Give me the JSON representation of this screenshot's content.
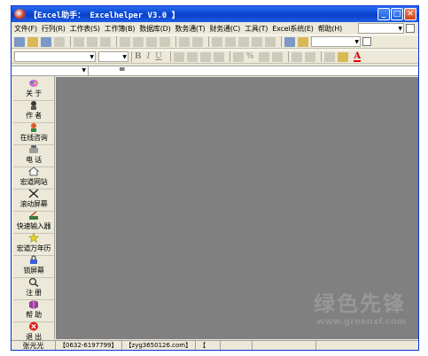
{
  "window": {
    "title": "【Excel助手： Excelhelper V3.0 】",
    "controls": {
      "minimize": "_",
      "maximize": "□",
      "close": "✕"
    }
  },
  "menu": {
    "items": [
      "文件(F)",
      "行列(R)",
      "工作表(S)",
      "工作簿(B)",
      "数据库(D)",
      "数务通(T)",
      "财务通(C)",
      "工具(T)",
      "Excel系统(E)",
      "帮助(H)"
    ]
  },
  "toolbar": {
    "bold": "B",
    "italic": "I",
    "underline": "U",
    "percent": "%",
    "font_color": "A"
  },
  "formula_bar": {
    "equals": "="
  },
  "sidebar": {
    "items": [
      {
        "label": "关 于",
        "icon": "about-icon"
      },
      {
        "label": "作 者",
        "icon": "author-icon"
      },
      {
        "label": "在线咨询",
        "icon": "online-consult-icon"
      },
      {
        "label": "电 话",
        "icon": "phone-icon"
      },
      {
        "label": "宏道网站",
        "icon": "website-icon"
      },
      {
        "label": "滚动屏幕",
        "icon": "scroll-screen-icon"
      },
      {
        "label": "快速输入器",
        "icon": "quick-input-icon"
      },
      {
        "label": "宏道万年历",
        "icon": "calendar-icon"
      },
      {
        "label": "锁屏幕",
        "icon": "lock-screen-icon"
      },
      {
        "label": "注 册",
        "icon": "register-icon"
      },
      {
        "label": "帮 助",
        "icon": "help-book-icon"
      },
      {
        "label": "退 出",
        "icon": "exit-icon"
      }
    ]
  },
  "status": {
    "user": "张元光",
    "phone": "【0632-6197799】",
    "email": "【zyg3650126.com】",
    "extra": "【"
  },
  "watermark": {
    "text": "绿色先锋",
    "url": "www.greenxf.com"
  },
  "colors": {
    "titlebar": "#0a49d6",
    "workspace": "#808080",
    "chrome": "#ece9d8"
  }
}
